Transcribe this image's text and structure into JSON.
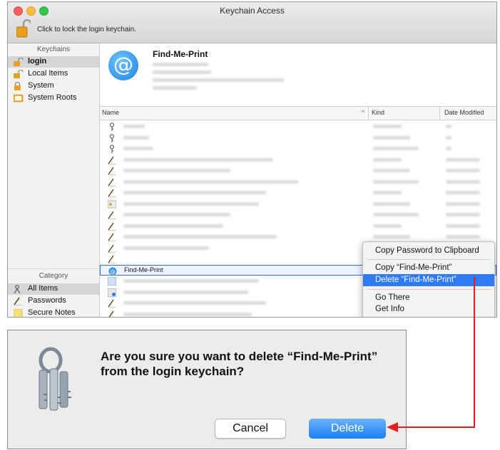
{
  "window": {
    "title": "Keychain Access",
    "lock_label": "Click to lock the login keychain."
  },
  "sidebar": {
    "keychains_heading": "Keychains",
    "keychains": [
      {
        "label": "login",
        "icon": "unlocked-padlock-icon",
        "selected": true
      },
      {
        "label": "Local Items",
        "icon": "unlocked-padlock-icon"
      },
      {
        "label": "System",
        "icon": "locked-padlock-icon"
      },
      {
        "label": "System Roots",
        "icon": "folder-icon"
      }
    ],
    "category_heading": "Category",
    "categories": [
      {
        "label": "All Items",
        "icon": "people-icon",
        "selected": true
      },
      {
        "label": "Passwords",
        "icon": "pen-icon"
      },
      {
        "label": "Secure Notes",
        "icon": "note-icon"
      }
    ]
  },
  "detail": {
    "title": "Find-Me-Print",
    "icon": "at-sign-icon"
  },
  "table": {
    "columns": [
      "Name",
      "Kind",
      "Date Modified"
    ],
    "selected_row": "Find-Me-Print"
  },
  "context_menu": {
    "items": [
      "Copy Password to Clipboard",
      "Copy “Find-Me-Print”",
      "Delete “Find-Me-Print”",
      "Go There",
      "Get Info"
    ],
    "highlighted": "Delete “Find-Me-Print”"
  },
  "dialog": {
    "message": "Are you sure you want to delete “Find-Me-Print” from the login keychain?",
    "cancel_label": "Cancel",
    "delete_label": "Delete"
  },
  "colors": {
    "accent": "#2f7bf5",
    "annotation": "#e02020"
  }
}
